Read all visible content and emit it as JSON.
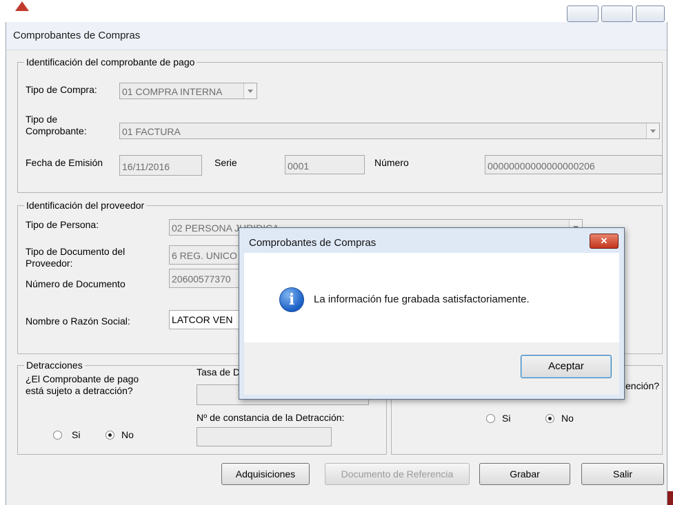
{
  "window_title": "Comprobantes de Compras",
  "identificacion": {
    "legend": "Identificación del comprobante de pago",
    "tipo_compra_label": "Tipo de Compra:",
    "tipo_compra_value": "01 COMPRA INTERNA",
    "tipo_comprobante_label_1": "Tipo de",
    "tipo_comprobante_label_2": "Comprobante:",
    "tipo_comprobante_value": "01 FACTURA",
    "fecha_label": "Fecha de Emisión",
    "fecha_value": "16/11/2016",
    "serie_label": "Serie",
    "serie_value": "0001",
    "numero_label": "Número",
    "numero_value": "00000000000000000206"
  },
  "proveedor": {
    "legend": "Identificación del proveedor",
    "tipo_persona_label": "Tipo de Persona:",
    "tipo_persona_value": "02 PERSONA JURIDICA",
    "tipo_doc_label_1": "Tipo de Documento del",
    "tipo_doc_label_2": "Proveedor:",
    "tipo_doc_value": "6 REG. UNICO",
    "numero_doc_label": "Número de Documento",
    "numero_doc_value": "20600577370",
    "razon_social_label": "Nombre o Razón Social:",
    "razon_social_value": "LATCOR VEN"
  },
  "detracciones": {
    "legend": "Detracciones",
    "question_1": "¿El Comprobante de pago",
    "question_2": "está sujeto a detracción?",
    "si_label": "Si",
    "no_label": "No",
    "selected": "No",
    "tasa_label": "Tasa de D",
    "constancia_label": "Nº de constancia de la Detracción:"
  },
  "retencion": {
    "question_suffix": "ención?",
    "si_label": "Si",
    "no_label": "No",
    "selected": "No"
  },
  "buttons": {
    "adquisiciones": "Adquisiciones",
    "documento_referencia": "Documento de Referencia",
    "grabar": "Grabar",
    "salir": "Salir"
  },
  "dialog": {
    "title": "Comprobantes de Compras",
    "close_glyph": "✕",
    "icon_glyph": "i",
    "message": "La información fue grabada satisfactoriamente.",
    "ok_label": "Aceptar"
  }
}
